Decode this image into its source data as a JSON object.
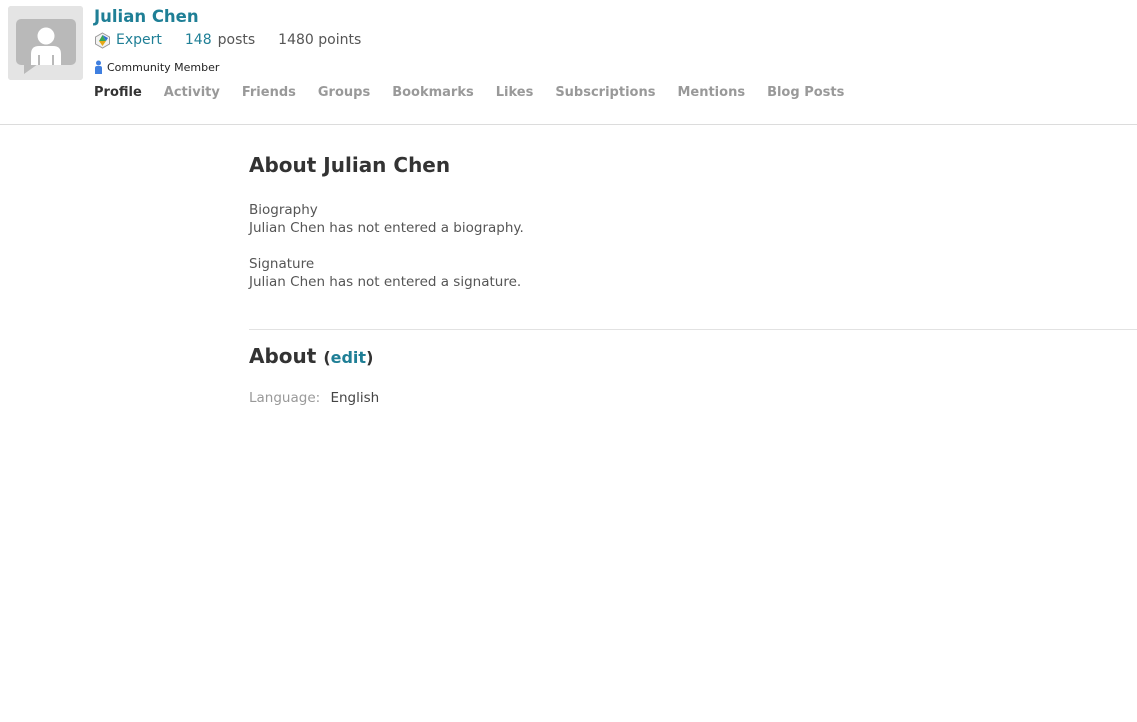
{
  "profile": {
    "name": "Julian Chen",
    "rank": "Expert",
    "posts_count": "148",
    "posts_word": "posts",
    "points": "1480 points",
    "member_type": "Community Member"
  },
  "tabs": [
    {
      "label": "Profile",
      "active": true
    },
    {
      "label": "Activity"
    },
    {
      "label": "Friends"
    },
    {
      "label": "Groups"
    },
    {
      "label": "Bookmarks"
    },
    {
      "label": "Likes"
    },
    {
      "label": "Subscriptions"
    },
    {
      "label": "Mentions"
    },
    {
      "label": "Blog Posts"
    }
  ],
  "about": {
    "title": "About Julian Chen",
    "biography_label": "Biography",
    "biography_value": "Julian Chen has not entered a biography.",
    "signature_label": "Signature",
    "signature_value": "Julian Chen has not entered a signature."
  },
  "about_section": {
    "title": "About",
    "edit_label": "edit",
    "language_label": "Language:",
    "language_value": "English"
  },
  "colors": {
    "link": "#1f7f96",
    "muted": "#999999",
    "text": "#333333"
  },
  "icons": {
    "avatar": "default-user-avatar-icon",
    "rank": "expert-rank-icon",
    "member": "community-member-icon"
  }
}
